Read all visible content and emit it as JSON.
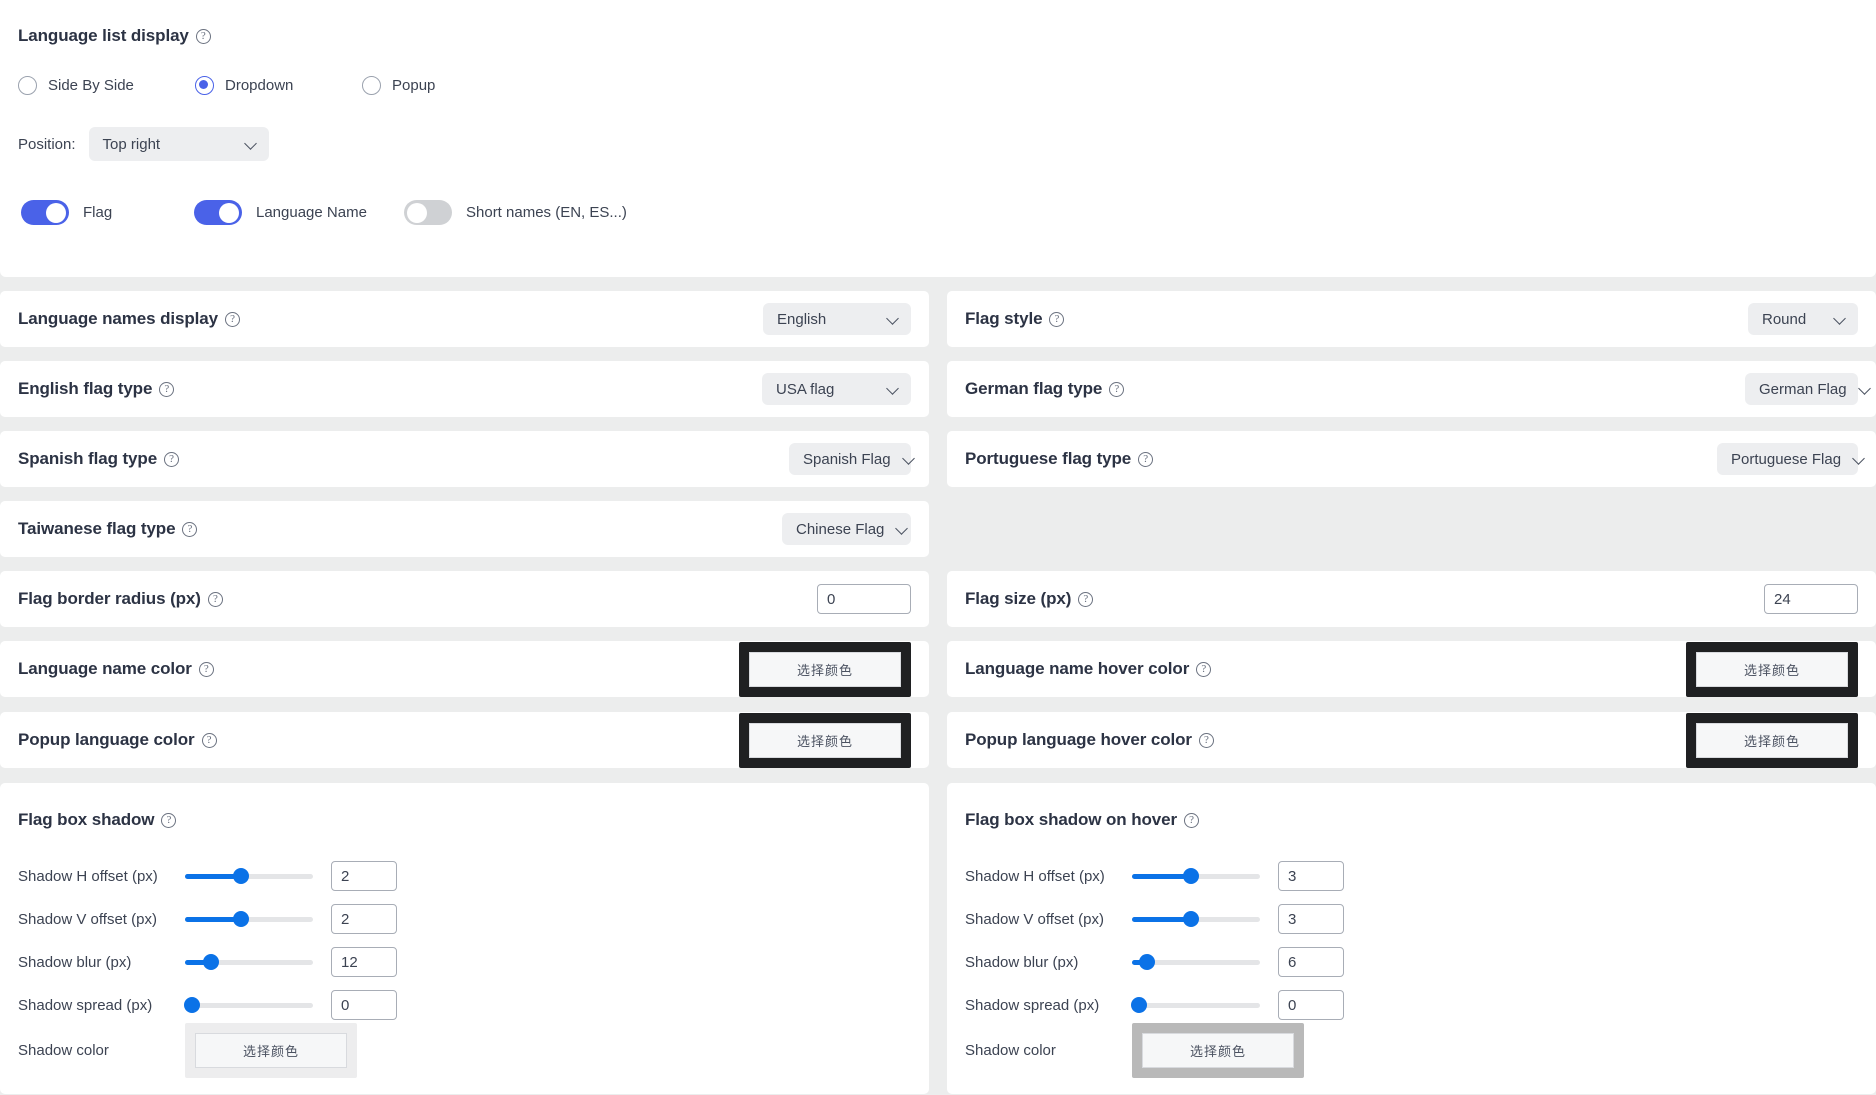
{
  "top_panel": {
    "title": "Language list display",
    "help_glyph": "?",
    "display_options": [
      {
        "label": "Side By Side",
        "selected": false
      },
      {
        "label": "Dropdown",
        "selected": true
      },
      {
        "label": "Popup",
        "selected": false
      }
    ],
    "position": {
      "label": "Position:",
      "value": "Top right"
    },
    "toggles": [
      {
        "label": "Flag",
        "on": true
      },
      {
        "label": "Language Name",
        "on": true
      },
      {
        "label": "Short names (EN, ES...)",
        "on": false
      }
    ]
  },
  "left_column": [
    {
      "label": "Language names display",
      "control": "select",
      "value": "English"
    },
    {
      "label": "English flag type",
      "control": "select",
      "value": "USA flag"
    },
    {
      "label": "Spanish flag type",
      "control": "select",
      "value": "Spanish Flag"
    },
    {
      "label": "Taiwanese flag type",
      "control": "select",
      "value": "Chinese Flag"
    },
    {
      "label": "Flag border radius (px)",
      "control": "number",
      "value": "0"
    },
    {
      "label": "Language name color",
      "control": "color",
      "value": "选择颜色",
      "swatch": "#1f2022"
    },
    {
      "label": "Popup language color",
      "control": "color",
      "value": "选择颜色",
      "swatch": "#1f2022"
    }
  ],
  "right_column": [
    {
      "label": "Flag style",
      "control": "select",
      "value": "Round"
    },
    {
      "label": "German flag type",
      "control": "select",
      "value": "German Flag"
    },
    {
      "label": "Portuguese flag type",
      "control": "select",
      "value": "Portuguese Flag"
    },
    {
      "label": "Flag size (px)",
      "control": "number",
      "value": "24"
    },
    {
      "label": "Language name hover color",
      "control": "color",
      "value": "选择颜色",
      "swatch": "#1f2022"
    },
    {
      "label": "Popup language hover color",
      "control": "color",
      "value": "选择颜色",
      "swatch": "#1f2022"
    }
  ],
  "flag_box_shadow": {
    "title": "Flag box shadow",
    "sliders": [
      {
        "label": "Shadow H offset (px)",
        "value": "2",
        "percent": 44
      },
      {
        "label": "Shadow V offset (px)",
        "value": "2",
        "percent": 44
      },
      {
        "label": "Shadow blur (px)",
        "value": "12",
        "percent": 20
      },
      {
        "label": "Shadow spread (px)",
        "value": "0",
        "percent": 0
      }
    ],
    "color_label": "Shadow color",
    "color_value": "选择颜色",
    "color_swatch": "#ededee"
  },
  "flag_box_shadow_hover": {
    "title": "Flag box shadow on hover",
    "sliders": [
      {
        "label": "Shadow H offset (px)",
        "value": "3",
        "percent": 46
      },
      {
        "label": "Shadow V offset (px)",
        "value": "3",
        "percent": 46
      },
      {
        "label": "Shadow blur (px)",
        "value": "6",
        "percent": 12
      },
      {
        "label": "Shadow spread (px)",
        "value": "0",
        "percent": 0
      }
    ],
    "color_label": "Shadow color",
    "color_value": "选择颜色",
    "color_swatch": "#b9b9b9"
  },
  "colors": {
    "accent_blue": "#4a62e8",
    "slider_blue": "#0b72e7",
    "page_bg": "#eceded",
    "panel_bg": "#ffffff",
    "text": "#2c3344"
  }
}
